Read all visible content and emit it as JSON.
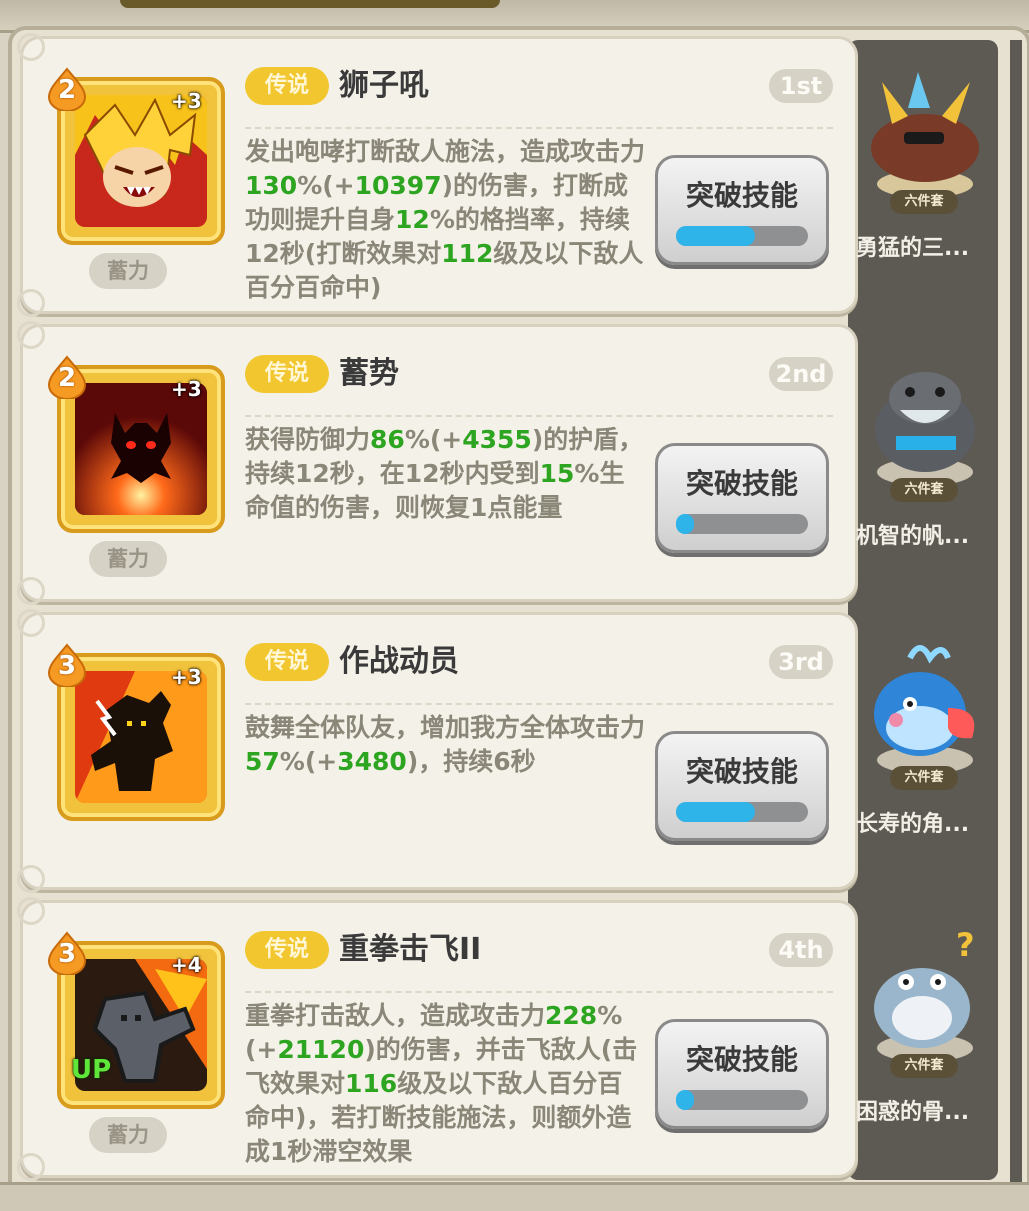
{
  "colors": {
    "highlight_green": "#2da520",
    "rarity_gold": "#f2c62e",
    "progress_blue": "#2fb4ea",
    "panel_bg": "#f4f1e8"
  },
  "skills": [
    {
      "level": "2",
      "plus": "+3",
      "up": "",
      "charge": "蓄力",
      "rarity": "传说",
      "name": "狮子吼",
      "rank": "1st",
      "icon": "roaring-lion-hero-icon",
      "desc": [
        {
          "t": "发出咆哮打断敌人施法，造成攻击力",
          "g": false
        },
        {
          "t": "130",
          "g": true
        },
        {
          "t": "%(+",
          "g": false
        },
        {
          "t": "10397",
          "g": true
        },
        {
          "t": ")的伤害，打断成功则提升自身",
          "g": false
        },
        {
          "t": "12",
          "g": true
        },
        {
          "t": "%的格挡率，持续12秒(打断效果对",
          "g": false
        },
        {
          "t": "112",
          "g": true
        },
        {
          "t": "级及以下敌人百分百命中)",
          "g": false
        }
      ],
      "button": "突破技能",
      "progress": 0.6,
      "pet": {
        "name": "勇猛的三...",
        "tag": "六件套",
        "icon": "horned-beast-pet-icon"
      }
    },
    {
      "level": "2",
      "plus": "+3",
      "up": "",
      "charge": "蓄力",
      "rarity": "传说",
      "name": "蓄势",
      "rank": "2nd",
      "icon": "demon-silhouette-shield-icon",
      "desc": [
        {
          "t": "获得防御力",
          "g": false
        },
        {
          "t": "86",
          "g": true
        },
        {
          "t": "%(+",
          "g": false
        },
        {
          "t": "4355",
          "g": true
        },
        {
          "t": ")的护盾，持续12秒，在12秒内受到",
          "g": false
        },
        {
          "t": "15",
          "g": true
        },
        {
          "t": "%生命值的伤害，则恢复1点能量",
          "g": false
        }
      ],
      "button": "突破技能",
      "progress": 0.1,
      "pet": {
        "name": "机智的帆...",
        "tag": "六件套",
        "icon": "hippo-pet-icon"
      }
    },
    {
      "level": "3",
      "plus": "+3",
      "up": "",
      "charge": "",
      "rarity": "传说",
      "name": "作战动员",
      "rank": "3rd",
      "icon": "rallying-warrior-icon",
      "desc": [
        {
          "t": "鼓舞全体队友，增加我方全体攻击力",
          "g": false
        },
        {
          "t": "57",
          "g": true
        },
        {
          "t": "%(+",
          "g": false
        },
        {
          "t": "3480",
          "g": true
        },
        {
          "t": ")，持续6秒",
          "g": false
        }
      ],
      "button": "突破技能",
      "progress": 0.6,
      "pet": {
        "name": "长寿的角...",
        "tag": "六件套",
        "icon": "whale-pet-icon"
      }
    },
    {
      "level": "3",
      "plus": "+4",
      "up": "UP",
      "charge": "蓄力",
      "rarity": "传说",
      "name": "重拳击飞II",
      "rank": "4th",
      "icon": "heavy-punch-icon",
      "desc": [
        {
          "t": "重拳打击敌人，造成攻击力",
          "g": false
        },
        {
          "t": "228",
          "g": true
        },
        {
          "t": "%(+",
          "g": false
        },
        {
          "t": "21120",
          "g": true
        },
        {
          "t": ")的伤害，并击飞敌人(击飞效果对",
          "g": false
        },
        {
          "t": "116",
          "g": true
        },
        {
          "t": "级及以下敌人百分百命中)，若打断技能施法，则额外造成1秒滞空效果",
          "g": false
        }
      ],
      "button": "突破技能",
      "progress": 0.08,
      "pet": {
        "name": "困惑的骨...",
        "tag": "六件套",
        "icon": "confused-dino-pet-icon"
      }
    }
  ]
}
